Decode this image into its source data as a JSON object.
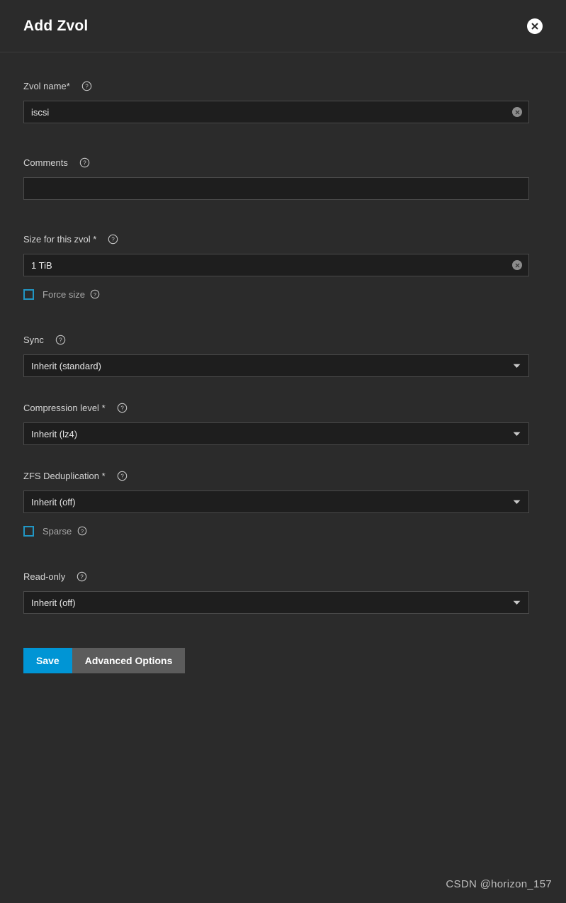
{
  "dialog": {
    "title": "Add Zvol",
    "close_icon": "close-icon"
  },
  "fields": {
    "zvol_name": {
      "label": "Zvol name",
      "required_marker": "*",
      "help_icon": "help-circle-icon",
      "value": "iscsi",
      "placeholder": "",
      "clear_icon": "clear-circle-icon"
    },
    "comments": {
      "label": "Comments",
      "required_marker": "",
      "help_icon": "help-circle-icon",
      "value": "",
      "placeholder": ""
    },
    "size_for_this_zvol": {
      "label": "Size for this zvol",
      "required_marker": "*",
      "help_icon": "help-circle-icon",
      "value": "1 TiB",
      "placeholder": "",
      "clear_icon": "clear-circle-icon"
    },
    "force_size": {
      "label": "Force size",
      "checked": false,
      "help_icon": "help-circle-icon"
    },
    "sync": {
      "label": "Sync",
      "required_marker": "",
      "help_icon": "help-circle-icon",
      "value": "Inherit (standard)",
      "chevron_icon": "chevron-down-icon"
    },
    "compression_level": {
      "label": "Compression level",
      "required_marker": "*",
      "help_icon": "help-circle-icon",
      "value": "Inherit (lz4)",
      "chevron_icon": "chevron-down-icon"
    },
    "zfs_deduplication": {
      "label": "ZFS Deduplication",
      "required_marker": "*",
      "help_icon": "help-circle-icon",
      "value": "Inherit (off)",
      "chevron_icon": "chevron-down-icon"
    },
    "sparse": {
      "label": "Sparse",
      "checked": false,
      "help_icon": "help-circle-icon"
    },
    "read_only": {
      "label": "Read-only",
      "required_marker": "",
      "help_icon": "help-circle-icon",
      "value": "Inherit (off)",
      "chevron_icon": "chevron-down-icon"
    }
  },
  "actions": {
    "save_label": "Save",
    "advanced_options_label": "Advanced Options"
  },
  "watermark": {
    "text": "CSDN @horizon_157"
  },
  "colors": {
    "background": "#2b2b2b",
    "input_background": "#1e1e1e",
    "input_border": "#4a4a4a",
    "accent_blue": "#0095d5",
    "checkbox_border": "#2196c4",
    "advanced_button": "#5c5c5c",
    "title_text": "#ffffff",
    "label_text": "#d6d6d6",
    "value_text": "#e8e8e8"
  }
}
